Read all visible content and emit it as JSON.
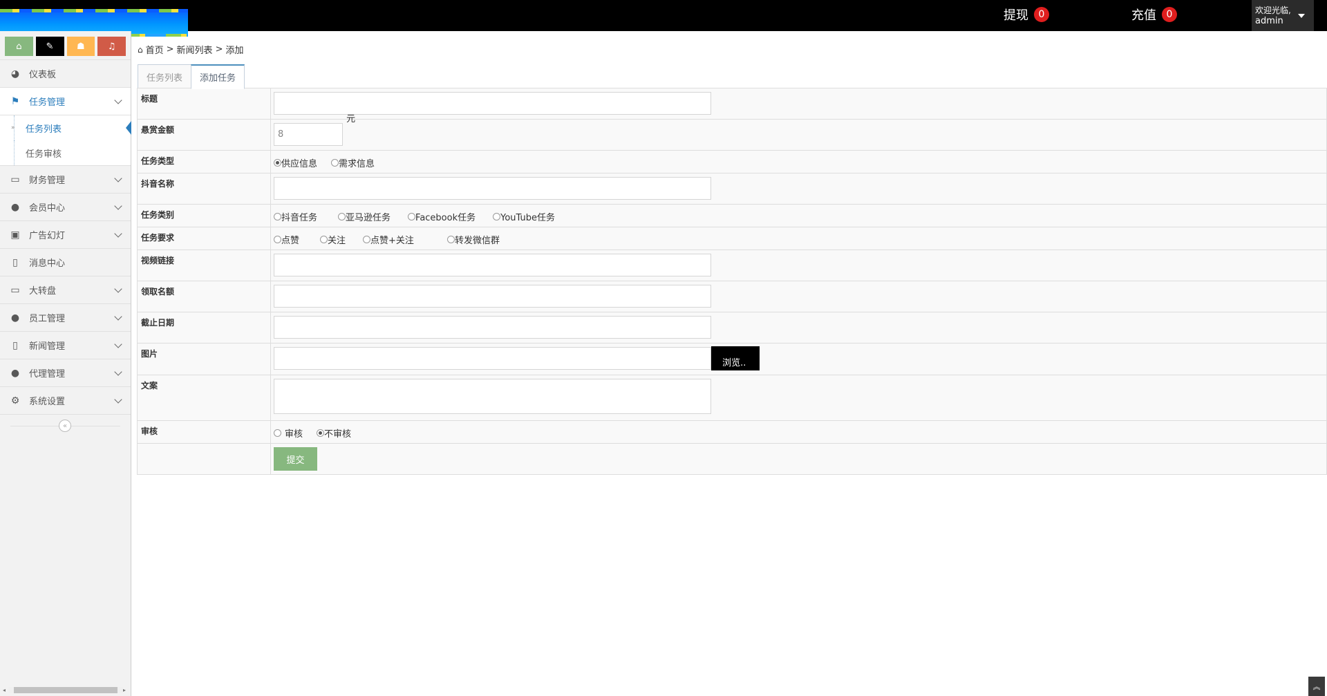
{
  "topbar": {
    "withdraw_label": "提现",
    "withdraw_count": "0",
    "recharge_label": "充值",
    "recharge_count": "0",
    "welcome": "欢迎光临,",
    "username": "admin"
  },
  "sidebar": {
    "items": [
      {
        "label": "仪表板",
        "icon": "dashboard-icon"
      },
      {
        "label": "任务管理",
        "icon": "flag-icon"
      },
      {
        "label": "财务管理",
        "icon": "hdd-icon"
      },
      {
        "label": "会员中心",
        "icon": "user-icon"
      },
      {
        "label": "广告幻灯",
        "icon": "picture-icon"
      },
      {
        "label": "消息中心",
        "icon": "bookmark-icon"
      },
      {
        "label": "大转盘",
        "icon": "hdd-icon"
      },
      {
        "label": "员工管理",
        "icon": "user-icon"
      },
      {
        "label": "新闻管理",
        "icon": "bookmark-icon"
      },
      {
        "label": "代理管理",
        "icon": "user-icon"
      },
      {
        "label": "系统设置",
        "icon": "gear-icon"
      }
    ],
    "task_submenu": [
      "任务列表",
      "任务审核"
    ]
  },
  "breadcrumb": {
    "home": "首页",
    "sep": ">",
    "news_list": "新闻列表",
    "current": "添加"
  },
  "tabs": [
    "任务列表",
    "添加任务"
  ],
  "form": {
    "title_label": "标题",
    "reward_label": "悬赏金额",
    "reward_value": "8",
    "reward_unit": "元",
    "task_type_label": "任务类型",
    "task_type_options": [
      "供应信息",
      "需求信息"
    ],
    "douyin_name_label": "抖音名称",
    "task_category_label": "任务类别",
    "task_category_options": [
      "抖音任务",
      "亚马逊任务",
      "Facebook任务",
      "YouTube任务"
    ],
    "task_req_label": "任务要求",
    "task_req_options": [
      "点赞",
      "关注",
      "点赞+关注",
      "转发微信群"
    ],
    "video_link_label": "视频链接",
    "quota_label": "领取名额",
    "deadline_label": "截止日期",
    "image_label": "图片",
    "browse_label": "浏览..",
    "copy_label": "文案",
    "review_label": "审核",
    "review_options": [
      "审核",
      "不审核"
    ],
    "submit_label": "提交"
  },
  "colors": {
    "accent": "#2b7dbc",
    "submit": "#87b87f",
    "badge": "#e01e1e"
  }
}
